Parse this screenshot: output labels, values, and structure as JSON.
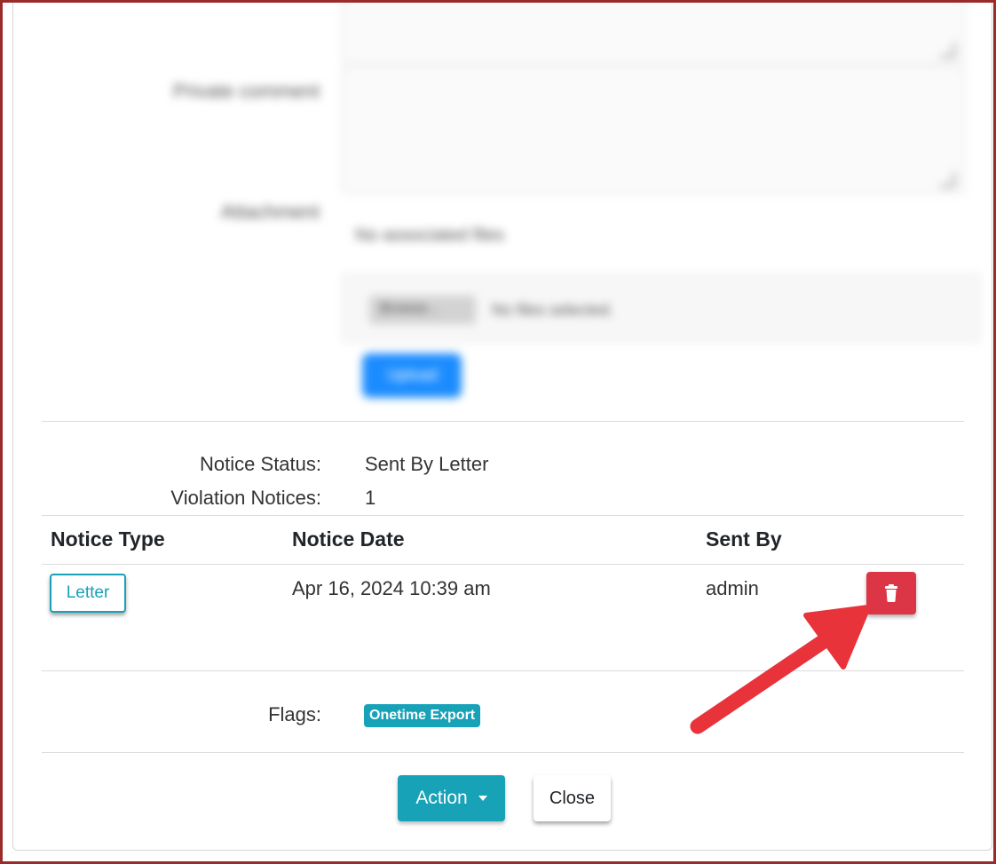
{
  "blurred_form": {
    "comment_label": "Private comment",
    "attachment_label": "Attachment",
    "no_files_text": "No associated files",
    "browse_label": "Browse...",
    "no_file_selected": "No files selected.",
    "upload_label": "Upload"
  },
  "notice_info": {
    "status_label": "Notice Status:",
    "status_value": "Sent By Letter",
    "count_label": "Violation Notices:",
    "count_value": "1"
  },
  "notices_table": {
    "headers": [
      "Notice Type",
      "Notice Date",
      "Sent By"
    ],
    "rows": [
      {
        "type": "Letter",
        "date": "Apr 16, 2024 10:39 am",
        "sent_by": "admin"
      }
    ]
  },
  "flags": {
    "label": "Flags:",
    "badges": [
      "Onetime Export"
    ]
  },
  "footer": {
    "action_label": "Action",
    "close_label": "Close"
  },
  "colors": {
    "info": "#17a2b8",
    "danger": "#dc3545",
    "annotation_arrow": "#e8333b",
    "frame": "#9b2a2a"
  },
  "icons": {
    "delete": "trash-icon",
    "dropdown": "caret-down-icon"
  }
}
